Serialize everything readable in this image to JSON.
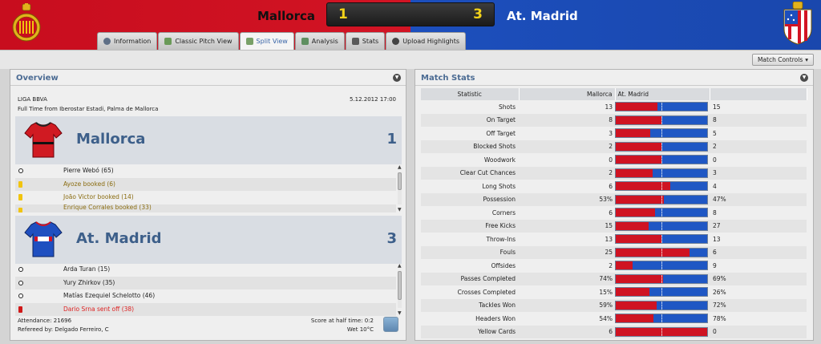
{
  "header": {
    "home_team": "Mallorca",
    "away_team": "At. Madrid",
    "home_score": "1",
    "away_score": "3",
    "colors": {
      "home": "#d21424",
      "away": "#1c4fbd",
      "score": "#f2d21a"
    }
  },
  "tabs": [
    {
      "label": "Information",
      "icon": "info-icon"
    },
    {
      "label": "Classic Pitch View",
      "icon": "pitch-icon"
    },
    {
      "label": "Split View",
      "icon": "split-view-icon",
      "active": true
    },
    {
      "label": "Analysis",
      "icon": "analysis-icon"
    },
    {
      "label": "Stats",
      "icon": "stats-icon"
    },
    {
      "label": "Upload Highlights",
      "icon": "upload-icon"
    }
  ],
  "match_controls": "Match Controls",
  "overview": {
    "title": "Overview",
    "competition": "LIGA BBVA",
    "date": "5.12.2012 17:00",
    "venue": "Full Time from Iberostar Estadi, Palma de Mallorca",
    "home": {
      "name": "Mallorca",
      "goals": "1",
      "events": [
        {
          "type": "goal",
          "text": "Pierre Webó (65)"
        },
        {
          "type": "booked",
          "text": "Ayoze booked (6)"
        },
        {
          "type": "booked",
          "text": "João Victor booked (14)"
        },
        {
          "type": "booked",
          "text": "Enrique Corrales booked (33)"
        }
      ]
    },
    "away": {
      "name": "At. Madrid",
      "goals": "3",
      "events": [
        {
          "type": "goal",
          "text": "Arda Turan (15)"
        },
        {
          "type": "goal",
          "text": "Yury Zhirkov (35)"
        },
        {
          "type": "goal",
          "text": "Matías Ezequiel Schelotto (46)"
        },
        {
          "type": "red",
          "text": "Dario Srna sent off (38)"
        }
      ]
    },
    "attendance": "Attendance: 21696",
    "referee": "Refereed by: Delgado Ferreiro, C",
    "halftime": "Score at half time: 0:2",
    "weather": "Wet 10°C"
  },
  "match_stats": {
    "title": "Match Stats",
    "headers": {
      "statistic": "Statistic",
      "home": "Mallorca",
      "away": "At. Madrid"
    },
    "rows": [
      {
        "name": "Shots",
        "home": "13",
        "away": "15",
        "home_share": 0.46
      },
      {
        "name": "On Target",
        "home": "8",
        "away": "8",
        "home_share": 0.5
      },
      {
        "name": "Off Target",
        "home": "3",
        "away": "5",
        "home_share": 0.38
      },
      {
        "name": "Blocked Shots",
        "home": "2",
        "away": "2",
        "home_share": 0.5
      },
      {
        "name": "Woodwork",
        "home": "0",
        "away": "0",
        "home_share": 0.5
      },
      {
        "name": "Clear Cut Chances",
        "home": "2",
        "away": "3",
        "home_share": 0.4
      },
      {
        "name": "Long Shots",
        "home": "6",
        "away": "4",
        "home_share": 0.6
      },
      {
        "name": "Possession",
        "home": "53%",
        "away": "47%",
        "home_share": 0.53
      },
      {
        "name": "Corners",
        "home": "6",
        "away": "8",
        "home_share": 0.43
      },
      {
        "name": "Free Kicks",
        "home": "15",
        "away": "27",
        "home_share": 0.36
      },
      {
        "name": "Throw-Ins",
        "home": "13",
        "away": "13",
        "home_share": 0.5
      },
      {
        "name": "Fouls",
        "home": "25",
        "away": "6",
        "home_share": 0.81
      },
      {
        "name": "Offsides",
        "home": "2",
        "away": "9",
        "home_share": 0.18
      },
      {
        "name": "Passes Completed",
        "home": "74%",
        "away": "69%",
        "home_share": 0.52
      },
      {
        "name": "Crosses Completed",
        "home": "15%",
        "away": "26%",
        "home_share": 0.37
      },
      {
        "name": "Tackles Won",
        "home": "59%",
        "away": "72%",
        "home_share": 0.45
      },
      {
        "name": "Headers Won",
        "home": "54%",
        "away": "78%",
        "home_share": 0.41
      },
      {
        "name": "Yellow Cards",
        "home": "6",
        "away": "0",
        "home_share": 1.0
      }
    ]
  }
}
